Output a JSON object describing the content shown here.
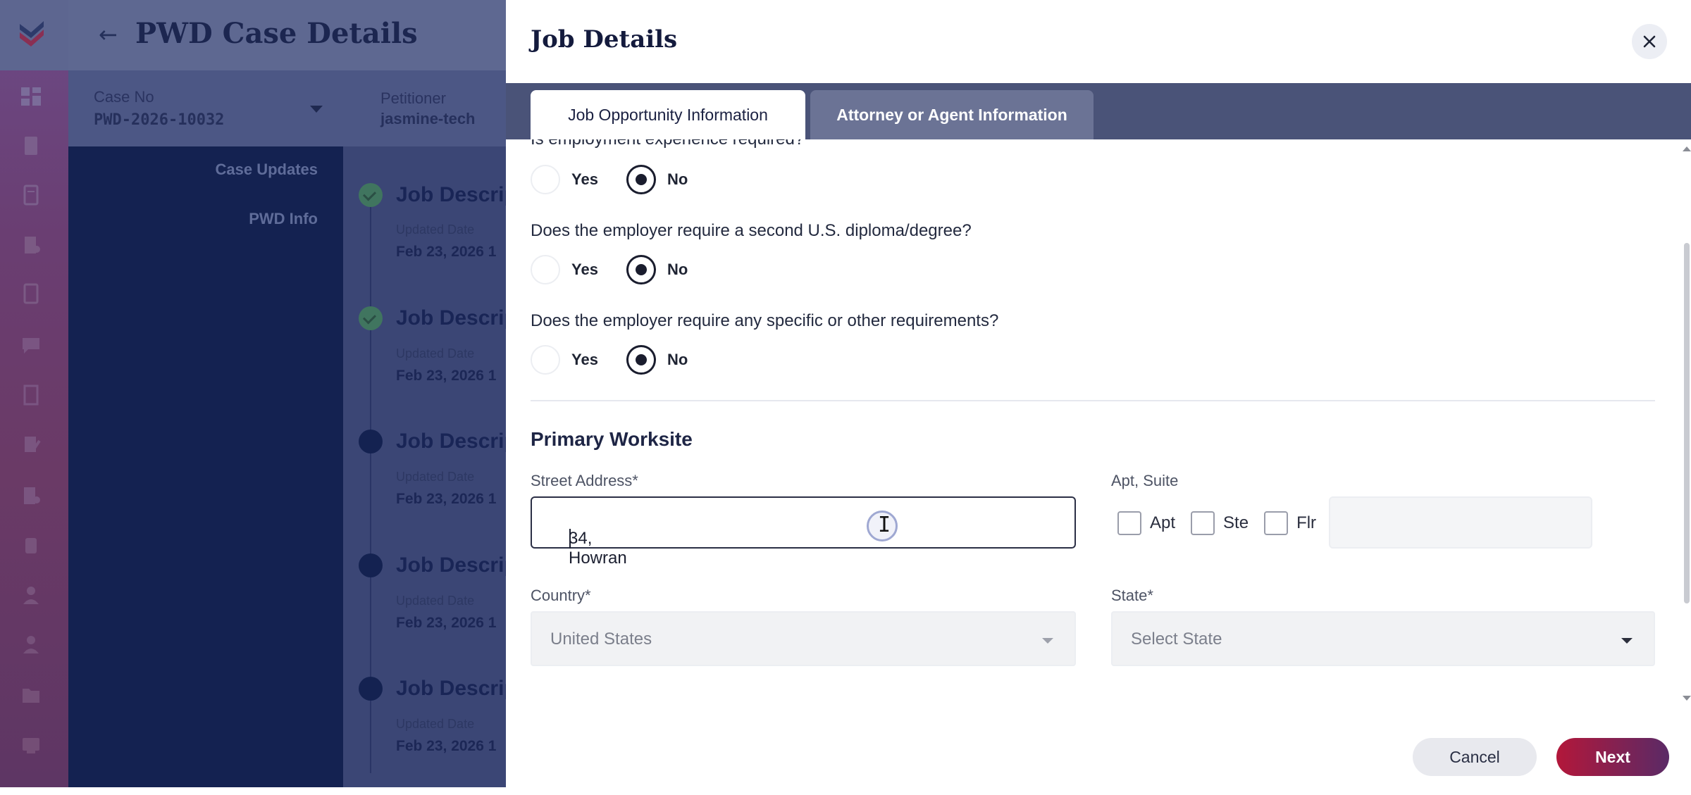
{
  "app": {
    "back_icon": "arrow-left-icon",
    "title": "PWD Case Details",
    "case_no_label": "Case No",
    "case_no_value": "PWD-2026-10032",
    "petitioner_label": "Petitioner",
    "petitioner_value": "jasmine-tech",
    "nav": [
      "Case Updates",
      "PWD Info"
    ],
    "timeline": [
      {
        "title": "Job Descrip",
        "sub": "Updated Date",
        "date": "Feb 23, 2026 1",
        "status": "done"
      },
      {
        "title": "Job Descrip",
        "sub": "Updated Date",
        "date": "Feb 23, 2026 1",
        "status": "done"
      },
      {
        "title": "Job Descrip",
        "sub": "Updated Date",
        "date": "Feb 23, 2026 1",
        "status": "pending"
      },
      {
        "title": "Job Descrip",
        "sub": "Updated Date",
        "date": "Feb 23, 2026 1",
        "status": "pending"
      },
      {
        "title": "Job Descrip",
        "sub": "Updated Date",
        "date": "Feb 23, 2026 1",
        "status": "pending"
      }
    ],
    "rail_icons": [
      "dashboard-icon",
      "document-icon",
      "form-icon",
      "building-icon",
      "checklist-icon",
      "chat-icon",
      "book-icon",
      "edit-icon",
      "office-icon",
      "clipboard-icon",
      "user-icon",
      "users-icon",
      "folder-icon",
      "card-icon"
    ]
  },
  "drawer": {
    "title": "Job Details",
    "close_icon": "close-icon",
    "tabs": [
      {
        "label": "Job Opportunity Information",
        "active": true
      },
      {
        "label": "Attorney or Agent Information",
        "active": false
      }
    ],
    "questions": [
      {
        "text": "Is employment experience required?",
        "yes": "Yes",
        "no": "No",
        "selected": "No"
      },
      {
        "text": "Does the employer require a second U.S. diploma/degree?",
        "yes": "Yes",
        "no": "No",
        "selected": "No"
      },
      {
        "text": "Does the employer require any specific or other requirements?",
        "yes": "Yes",
        "no": "No",
        "selected": "No"
      }
    ],
    "section_title": "Primary Worksite",
    "street_label": "Street Address*",
    "street_value": "34, Howran",
    "suite_label": "Apt, Suite",
    "suite_options": [
      "Apt",
      "Ste",
      "Flr"
    ],
    "suite_value": "",
    "country_label": "Country*",
    "country_value": "United States",
    "state_label": "State*",
    "state_placeholder": "Select State",
    "cancel_label": "Cancel",
    "next_label": "Next"
  },
  "colors": {
    "accent_start": "#b3173a",
    "accent_end": "#5a2a66",
    "tabbar": "#4a5378",
    "nav_dark": "#142251"
  }
}
